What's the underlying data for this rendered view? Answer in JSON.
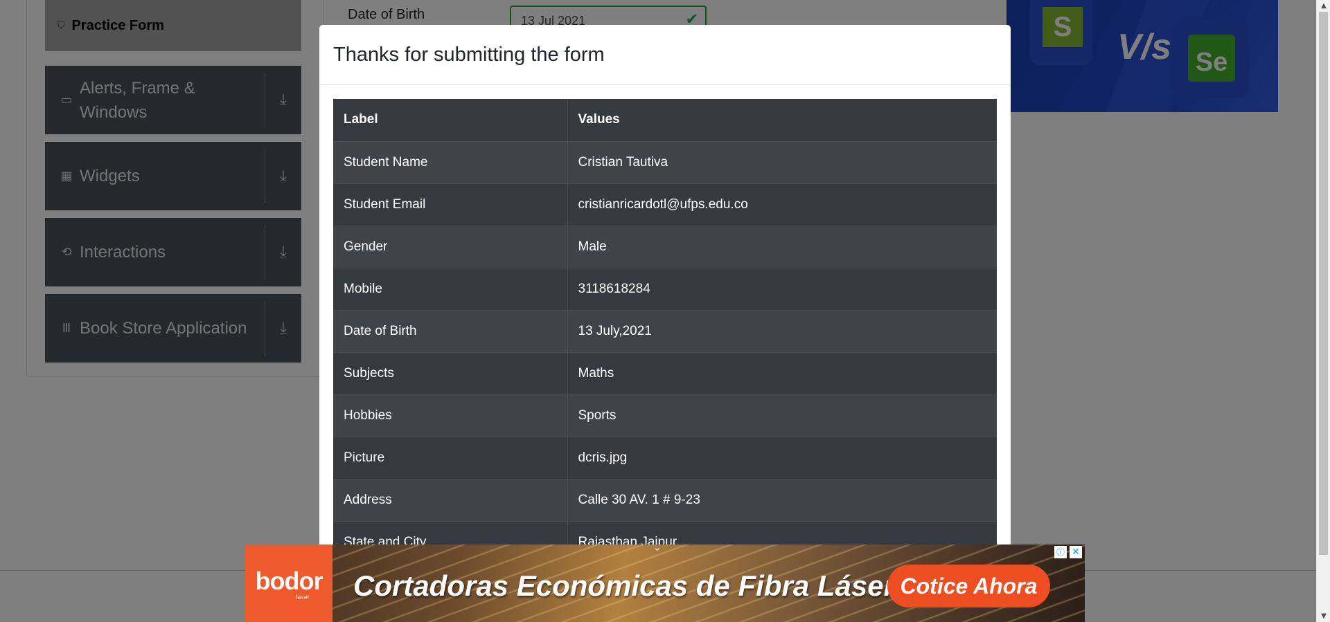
{
  "sidebar": {
    "active_item": {
      "icon": "html5-icon",
      "label": "Practice Form"
    },
    "groups": [
      {
        "icon": "window-icon",
        "label": "Alerts, Frame & Windows"
      },
      {
        "icon": "widgets-icon",
        "label": "Widgets"
      },
      {
        "icon": "interactions-icon",
        "label": "Interactions"
      },
      {
        "icon": "book-store-icon",
        "label": "Book Store Application"
      }
    ]
  },
  "form": {
    "dob_label": "Date of Birth",
    "dob_value": "13 Jul 2021"
  },
  "promo": {
    "left_letter": "S",
    "vs_text": "V/s",
    "right_letters": "Se"
  },
  "modal": {
    "title": "Thanks for submitting the form",
    "table": {
      "headers": [
        "Label",
        "Values"
      ],
      "rows": [
        [
          "Student Name",
          "Cristian Tautiva"
        ],
        [
          "Student Email",
          "cristianricardotl@ufps.edu.co"
        ],
        [
          "Gender",
          "Male"
        ],
        [
          "Mobile",
          "3118618284"
        ],
        [
          "Date of Birth",
          "13 July,2021"
        ],
        [
          "Subjects",
          "Maths"
        ],
        [
          "Hobbies",
          "Sports"
        ],
        [
          "Picture",
          "dcris.jpg"
        ],
        [
          "Address",
          "Calle 30 AV. 1 # 9-23"
        ],
        [
          "State and City",
          "Rajasthan Jaipur"
        ]
      ]
    }
  },
  "ad": {
    "brand": "bodor",
    "brand_sub": "laser",
    "headline": "Cortadoras Económicas de Fibra Láser",
    "cta": "Cotice Ahora"
  },
  "colors": {
    "backdrop": "rgba(0,0,0,0.5)",
    "table_dark": "#343a40",
    "table_stripe": "#3e444a",
    "success_green": "#28a745",
    "ad_orange": "#ee5a2b"
  }
}
